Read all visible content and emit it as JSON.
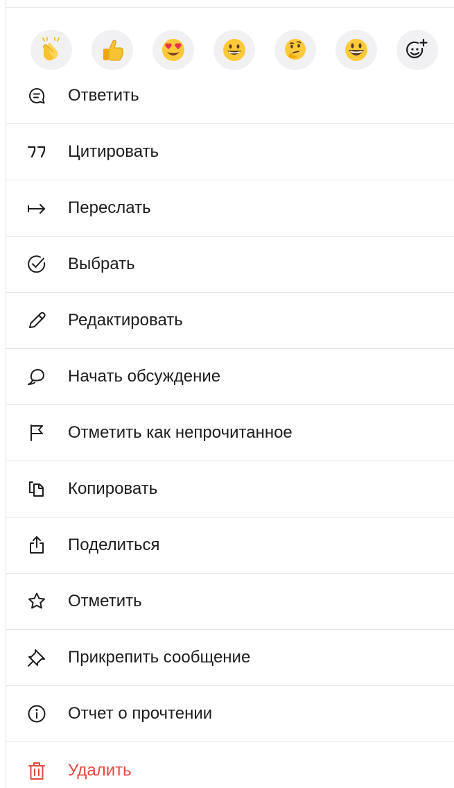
{
  "colors": {
    "text": "#1c1c1e",
    "danger": "#e5483f",
    "icon": "#1c1c1e",
    "reaction_bg": "#f1f1f4",
    "divider": "#e4e4e6"
  },
  "reactions": [
    {
      "emoji": "👏",
      "icon": "clapping-hands"
    },
    {
      "emoji": "👍",
      "icon": "thumbs-up"
    },
    {
      "emoji": "😍",
      "icon": "heart-eyes-face"
    },
    {
      "emoji": "😀",
      "icon": "grinning-face"
    },
    {
      "emoji": "🤔",
      "icon": "thinking-face"
    },
    {
      "emoji": "😃",
      "icon": "smiley-face"
    },
    {
      "emoji": "",
      "icon": "add-reaction"
    }
  ],
  "menu": {
    "items": [
      {
        "label": "Ответить",
        "icon": "reply-bubble"
      },
      {
        "label": "Цитировать",
        "icon": "quote"
      },
      {
        "label": "Переслать",
        "icon": "forward-arrow"
      },
      {
        "label": "Выбрать",
        "icon": "check-circle"
      },
      {
        "label": "Редактировать",
        "icon": "pencil"
      },
      {
        "label": "Начать обсуждение",
        "icon": "discussion-bubble"
      },
      {
        "label": "Отметить как непрочитанное",
        "icon": "flag"
      },
      {
        "label": "Копировать",
        "icon": "copy"
      },
      {
        "label": "Поделиться",
        "icon": "share"
      },
      {
        "label": "Отметить",
        "icon": "star"
      },
      {
        "label": "Прикрепить сообщение",
        "icon": "pin"
      },
      {
        "label": "Отчет о прочтении",
        "icon": "info-circle"
      },
      {
        "label": "Удалить",
        "icon": "trash",
        "danger": true
      }
    ]
  }
}
